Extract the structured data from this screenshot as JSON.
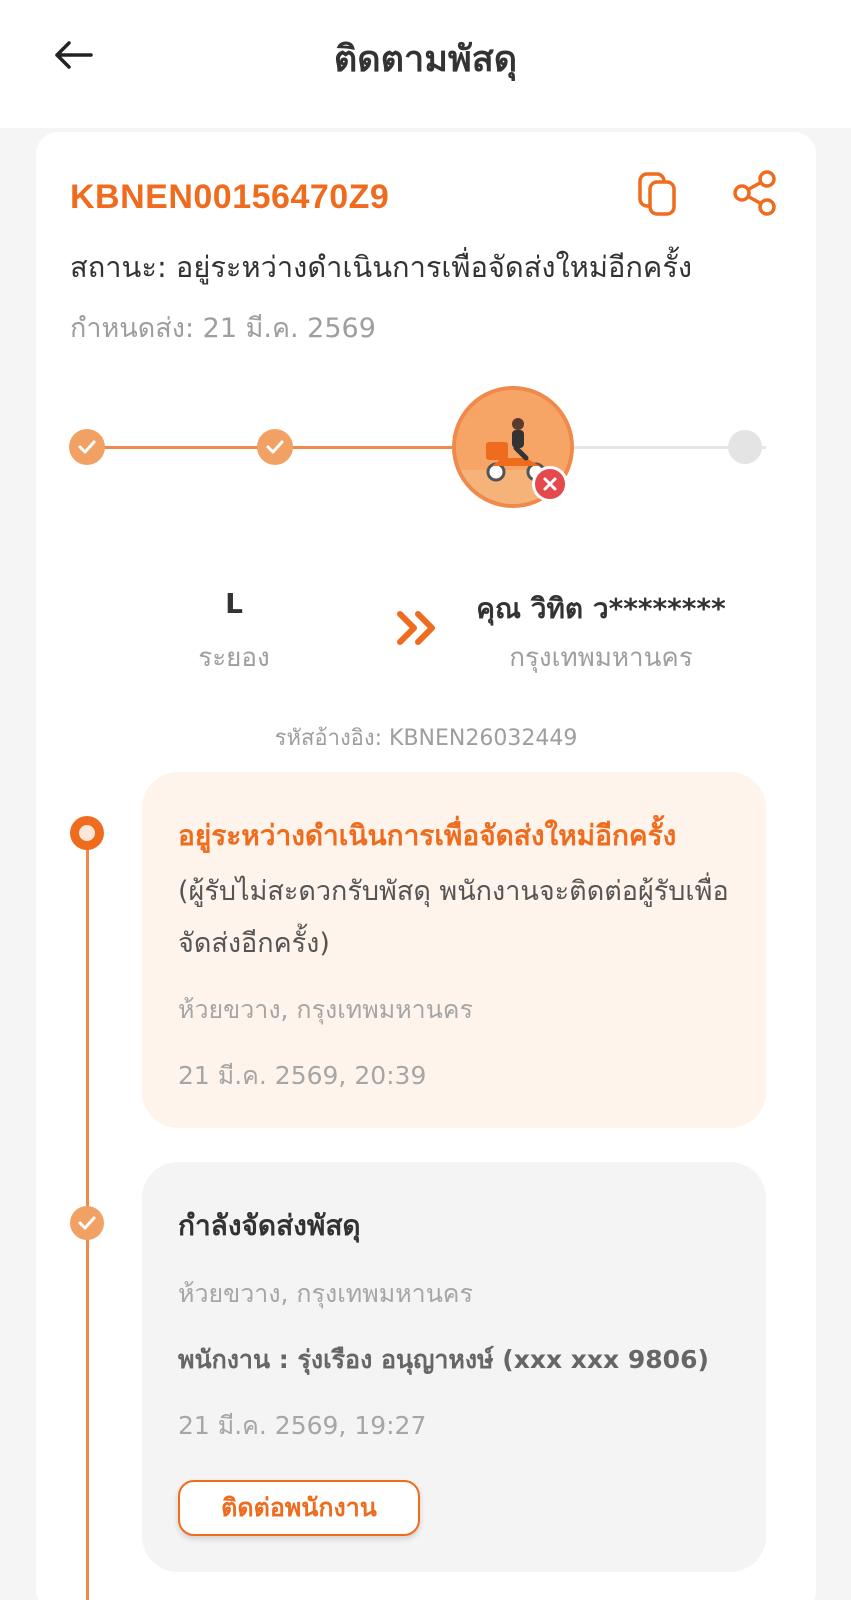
{
  "header": {
    "title": "ติดตามพัสดุ",
    "back_icon": "arrow-left-icon"
  },
  "parcel": {
    "tracking_number": "KBNEN00156470Z9",
    "status": "สถานะ: อยู่ระหว่างดำเนินการเพื่อจัดส่งใหม่อีกครั้ง",
    "due_date": "กำหนดส่ง: 21 มี.ค. 2569",
    "copy_icon": "copy-icon",
    "share_icon": "share-icon"
  },
  "progress": {
    "steps_total": 4,
    "steps_completed": 2,
    "current_step": 3,
    "current_state": "failed"
  },
  "route": {
    "sender_name": "L",
    "sender_city": "ระยอง",
    "receiver_name": "คุณ วิทิต ว********",
    "receiver_city": "กรุงเทพมหานคร",
    "reference": "รหัสอ้างอิง: KBNEN26032449"
  },
  "timeline": [
    {
      "title": "อยู่ระหว่างดำเนินการเพื่อจัดส่งใหม่อีกครั้ง",
      "description": "(ผู้รับไม่สะดวกรับพัสดุ พนักงานจะติดต่อผู้รับเพื่อจัดส่งอีกครั้ง)",
      "location": "ห้วยขวาง, กรุงเทพมหานคร",
      "time": "21 มี.ค. 2569, 20:39"
    },
    {
      "title": "กำลังจัดส่งพัสดุ",
      "location": "ห้วยขวาง, กรุงเทพมหานคร",
      "staff": "พนักงาน : รุ่งเรือง อนุญาหงษ์ (xxx xxx 9806)",
      "time": "21 มี.ค. 2569, 19:27",
      "button_label": "ติดต่อพนักงาน"
    }
  ],
  "colors": {
    "accent": "#ef6c1f",
    "accent_light": "#f2a165",
    "highlight_bg": "#fff4ec",
    "error": "#e5484d"
  }
}
